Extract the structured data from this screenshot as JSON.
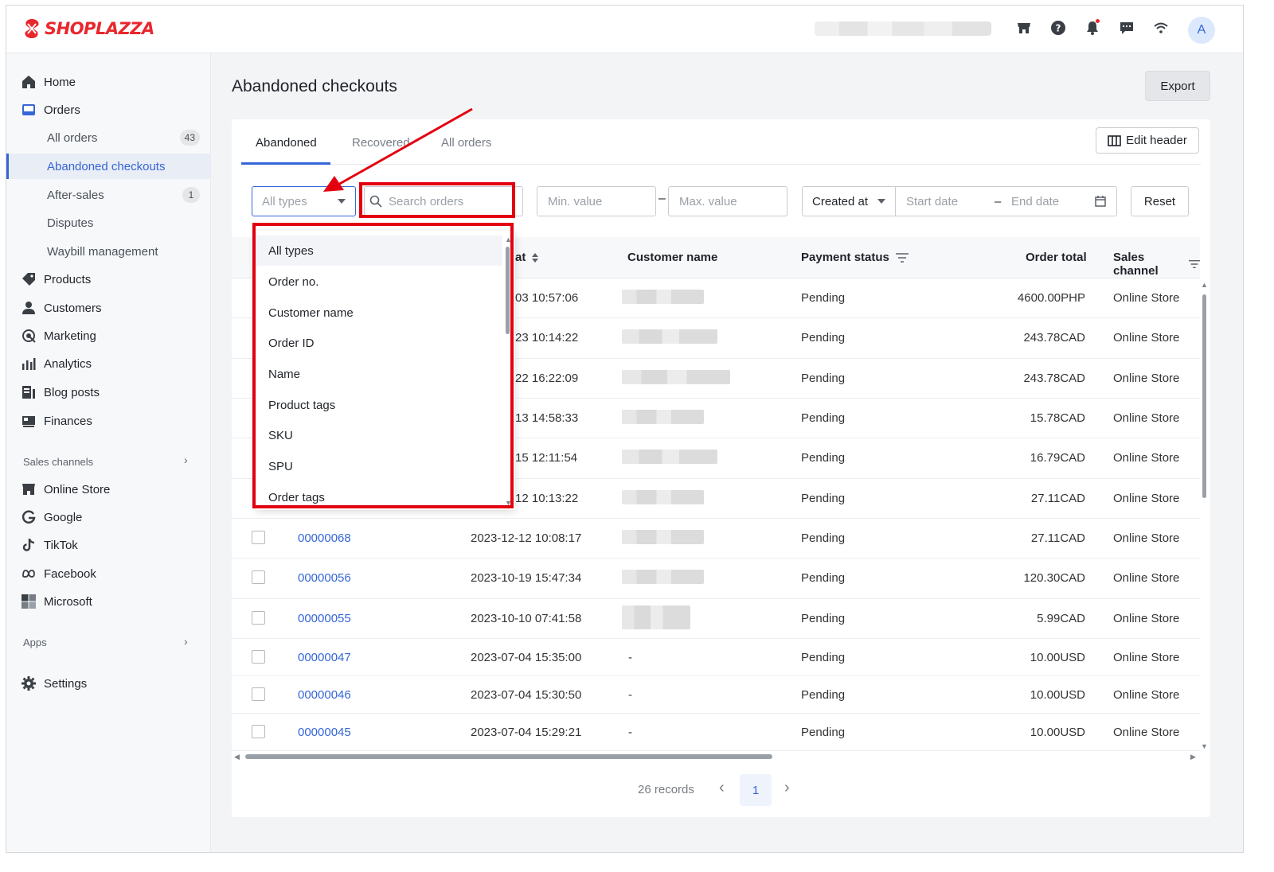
{
  "brand": {
    "name": "SHOPLAZZA",
    "color": "#e8272d"
  },
  "topbar": {
    "avatar_letter": "A",
    "icons": [
      "store-icon",
      "help-icon",
      "bell-icon",
      "chat-icon",
      "wifi-icon"
    ]
  },
  "sidebar": {
    "items": [
      {
        "label": "Home",
        "icon": "home-icon"
      },
      {
        "label": "Orders",
        "icon": "orders-icon"
      },
      {
        "label": "Products",
        "icon": "tag-icon"
      },
      {
        "label": "Customers",
        "icon": "person-icon"
      },
      {
        "label": "Marketing",
        "icon": "marketing-icon"
      },
      {
        "label": "Analytics",
        "icon": "bar-chart-icon"
      },
      {
        "label": "Blog posts",
        "icon": "blog-icon"
      },
      {
        "label": "Finances",
        "icon": "finance-icon"
      }
    ],
    "order_subitems": [
      {
        "label": "All orders",
        "badge": "43"
      },
      {
        "label": "Abandoned checkouts",
        "badge": ""
      },
      {
        "label": "After-sales",
        "badge": "1"
      },
      {
        "label": "Disputes",
        "badge": ""
      },
      {
        "label": "Waybill management",
        "badge": ""
      }
    ],
    "sales_channels_header": "Sales channels",
    "channels": [
      {
        "label": "Online Store",
        "icon": "store-icon"
      },
      {
        "label": "Google",
        "icon": "google-icon"
      },
      {
        "label": "TikTok",
        "icon": "tiktok-icon"
      },
      {
        "label": "Facebook",
        "icon": "meta-icon"
      },
      {
        "label": "Microsoft",
        "icon": "microsoft-icon"
      }
    ],
    "apps_header": "Apps",
    "settings": "Settings"
  },
  "page": {
    "title": "Abandoned checkouts",
    "export": "Export"
  },
  "tabs": [
    "Abandoned",
    "Recovered",
    "All orders"
  ],
  "edit_header": "Edit header",
  "filters": {
    "type_placeholder": "All types",
    "search_placeholder": "Search orders",
    "min_placeholder": "Min. value",
    "max_placeholder": "Max. value",
    "date_field": "Created at",
    "start_date": "Start date",
    "end_date": "End date",
    "reset": "Reset"
  },
  "dropdown": {
    "options": [
      "All types",
      "Order no.",
      "Customer name",
      "Order ID",
      "Name",
      "Product tags",
      "SKU",
      "SPU",
      "Order tags"
    ],
    "selected": "All types"
  },
  "table": {
    "headers": {
      "created": "at",
      "customer": "Customer name",
      "payment": "Payment status",
      "total": "Order total",
      "channel": "Sales channel"
    },
    "rows": [
      {
        "order": "",
        "created": "-03 10:57:06",
        "customer": "",
        "payment": "Pending",
        "total": "4600.00PHP",
        "channel": "Online Store"
      },
      {
        "order": "",
        "created": "-23 10:14:22",
        "customer": "",
        "payment": "Pending",
        "total": "243.78CAD",
        "channel": "Online Store"
      },
      {
        "order": "",
        "created": "-22 16:22:09",
        "customer": "",
        "payment": "Pending",
        "total": "243.78CAD",
        "channel": "Online Store"
      },
      {
        "order": "",
        "created": "-13 14:58:33",
        "customer": "",
        "payment": "Pending",
        "total": "15.78CAD",
        "channel": "Online Store"
      },
      {
        "order": "",
        "created": "-15 12:11:54",
        "customer": "",
        "payment": "Pending",
        "total": "16.79CAD",
        "channel": "Online Store"
      },
      {
        "order": "",
        "created": "-12 10:13:22",
        "customer": "",
        "payment": "Pending",
        "total": "27.11CAD",
        "channel": "Online Store"
      },
      {
        "order": "00000068",
        "created": "2023-12-12 10:08:17",
        "customer": "",
        "payment": "Pending",
        "total": "27.11CAD",
        "channel": "Online Store"
      },
      {
        "order": "00000056",
        "created": "2023-10-19 15:47:34",
        "customer": "",
        "payment": "Pending",
        "total": "120.30CAD",
        "channel": "Online Store"
      },
      {
        "order": "00000055",
        "created": "2023-10-10 07:41:58",
        "customer": "",
        "payment": "Pending",
        "total": "5.99CAD",
        "channel": "Online Store"
      },
      {
        "order": "00000047",
        "created": "2023-07-04 15:35:00",
        "customer": "-",
        "payment": "Pending",
        "total": "10.00USD",
        "channel": "Online Store"
      },
      {
        "order": "00000046",
        "created": "2023-07-04 15:30:50",
        "customer": "-",
        "payment": "Pending",
        "total": "10.00USD",
        "channel": "Online Store"
      },
      {
        "order": "00000045",
        "created": "2023-07-04 15:29:21",
        "customer": "-",
        "payment": "Pending",
        "total": "10.00USD",
        "channel": "Online Store"
      }
    ]
  },
  "pagination": {
    "records": "26 records",
    "current_page": "1"
  },
  "colors": {
    "accent": "#3566d6",
    "highlight": "#e3000f"
  }
}
